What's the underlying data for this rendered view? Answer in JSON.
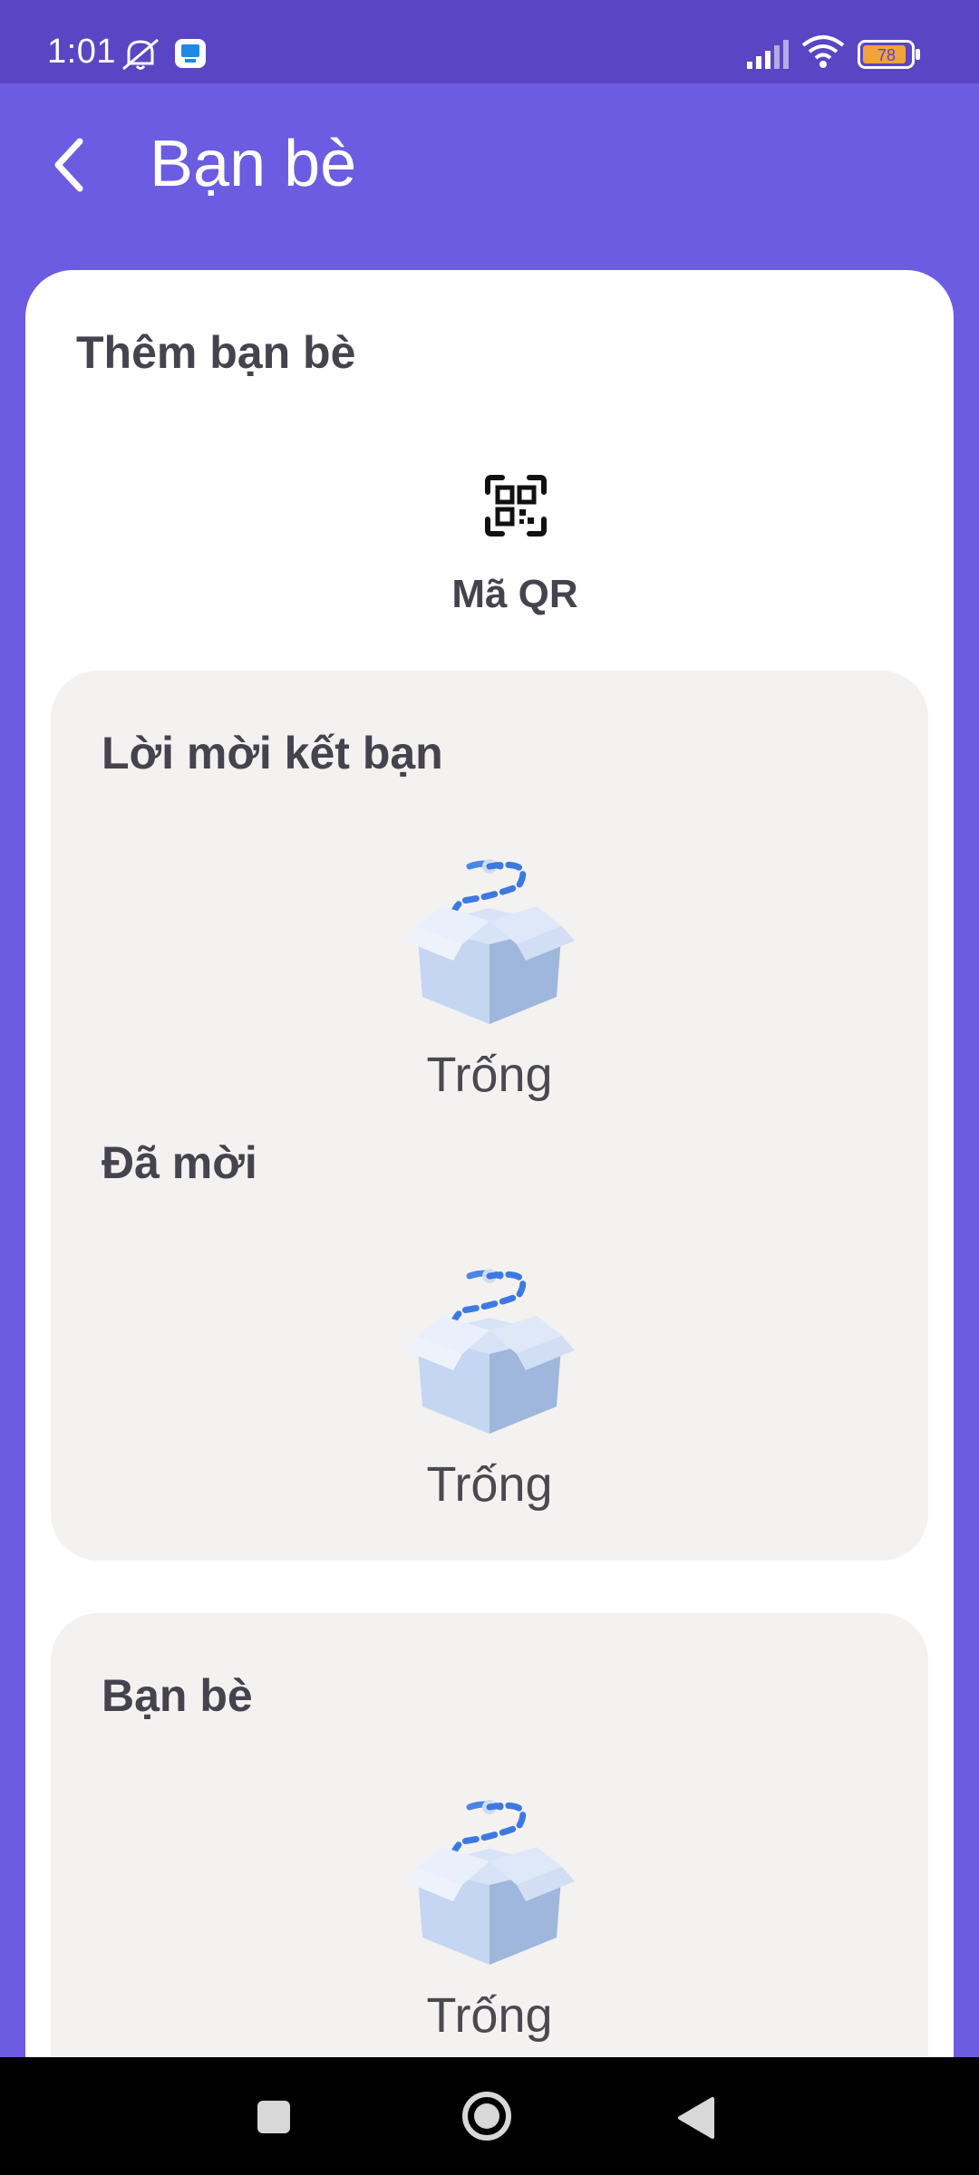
{
  "status_bar": {
    "time": "1:01",
    "battery": "78",
    "icons": [
      "notifications-off-icon",
      "app-notification-icon",
      "signal-icon",
      "wifi-icon",
      "battery-icon"
    ]
  },
  "header": {
    "title": "Bạn bè",
    "back_icon": "back-arrow-icon"
  },
  "add_friends": {
    "title": "Thêm bạn bè",
    "qr_label": "Mã QR",
    "qr_icon": "qr-code-icon"
  },
  "requests_panel": {
    "received_title": "Lời mời kết bạn",
    "received_empty": "Trống",
    "sent_title": "Đã mời",
    "sent_empty": "Trống"
  },
  "friends_panel": {
    "title": "Bạn bè",
    "empty": "Trống"
  },
  "nav_bar": {
    "icons": [
      "recents-square-icon",
      "home-circle-icon",
      "back-triangle-icon"
    ]
  },
  "colors": {
    "primary": "#6c5ce1",
    "status_bar": "#5a45c4",
    "panel_bg": "#f3f2f1",
    "text": "#45434d"
  }
}
